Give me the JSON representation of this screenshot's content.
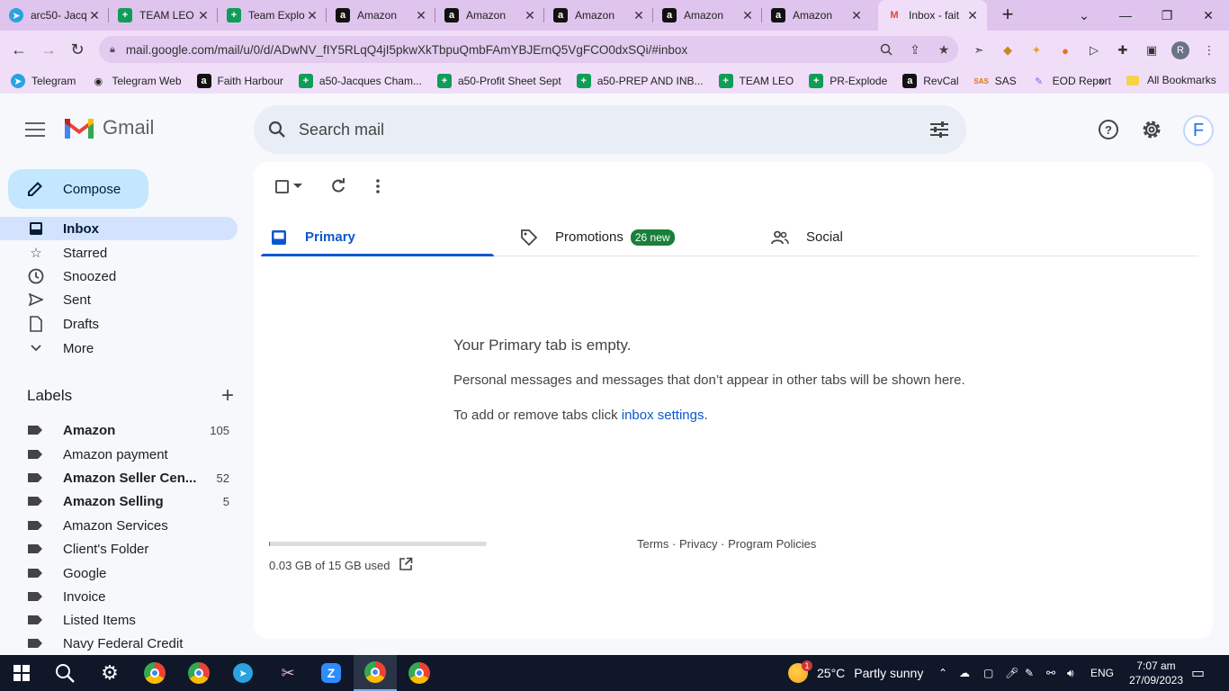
{
  "browser": {
    "tabs": [
      {
        "title": "arc50- Jacq",
        "favicon": "telegram-icon"
      },
      {
        "title": "TEAM LEO",
        "favicon": "sheets-icon"
      },
      {
        "title": "Team Explo",
        "favicon": "sheets-icon"
      },
      {
        "title": "Amazon",
        "favicon": "amazon-icon"
      },
      {
        "title": "Amazon",
        "favicon": "amazon-icon"
      },
      {
        "title": "Amazon",
        "favicon": "amazon-icon"
      },
      {
        "title": "Amazon",
        "favicon": "amazon-icon"
      },
      {
        "title": "Amazon",
        "favicon": "amazon-icon"
      },
      {
        "title": "Inbox - fait",
        "favicon": "gmail-icon",
        "active": true
      }
    ],
    "url": "mail.google.com/mail/u/0/d/ADwNV_fIY5RLqQ4jI5pkwXkTbpuQmbFAmYBJErnQ5VgFCO0dxSQi/#inbox",
    "profile_initial": "R",
    "bookmarks": [
      {
        "label": "Telegram",
        "icon": "telegram-icon"
      },
      {
        "label": "Telegram Web",
        "icon": "globe-icon"
      },
      {
        "label": "Faith Harbour",
        "icon": "amazon-icon"
      },
      {
        "label": "a50-Jacques Cham...",
        "icon": "sheets-icon"
      },
      {
        "label": "a50-Profit Sheet Sept",
        "icon": "sheets-icon"
      },
      {
        "label": "a50-PREP AND INB...",
        "icon": "sheets-icon"
      },
      {
        "label": "TEAM LEO",
        "icon": "sheets-icon"
      },
      {
        "label": "PR-Explode",
        "icon": "sheets-icon"
      },
      {
        "label": "RevCal",
        "icon": "amazon-icon"
      },
      {
        "label": "SAS",
        "icon": "sas-icon"
      },
      {
        "label": "EOD Report",
        "icon": "clickup-icon"
      }
    ],
    "bookmarks_more": "»",
    "all_bookmarks": "All Bookmarks"
  },
  "gmail": {
    "brand": "Gmail",
    "search_placeholder": "Search mail",
    "avatar_initial": "F",
    "compose_label": "Compose",
    "nav": [
      {
        "label": "Inbox",
        "icon": "inbox-icon",
        "active": true
      },
      {
        "label": "Starred",
        "icon": "star-icon"
      },
      {
        "label": "Snoozed",
        "icon": "clock-icon"
      },
      {
        "label": "Sent",
        "icon": "send-icon"
      },
      {
        "label": "Drafts",
        "icon": "draft-icon"
      },
      {
        "label": "More",
        "icon": "chevron-down-icon"
      }
    ],
    "labels_title": "Labels",
    "labels": [
      {
        "name": "Amazon",
        "count": "105",
        "bold": true
      },
      {
        "name": "Amazon payment",
        "count": "",
        "bold": false
      },
      {
        "name": "Amazon Seller Cen...",
        "count": "52",
        "bold": true
      },
      {
        "name": "Amazon Selling",
        "count": "5",
        "bold": true
      },
      {
        "name": "Amazon Services",
        "count": "",
        "bold": false
      },
      {
        "name": "Client's Folder",
        "count": "",
        "bold": false
      },
      {
        "name": "Google",
        "count": "",
        "bold": false
      },
      {
        "name": "Invoice",
        "count": "",
        "bold": false
      },
      {
        "name": "Listed Items",
        "count": "",
        "bold": false
      },
      {
        "name": "Navy Federal Credit",
        "count": "",
        "bold": false
      }
    ],
    "category_tabs": [
      {
        "label": "Primary",
        "icon": "inbox-icon",
        "active": true,
        "badge": ""
      },
      {
        "label": "Promotions",
        "icon": "tag-icon",
        "badge": "26 new"
      },
      {
        "label": "Social",
        "icon": "people-icon",
        "badge": ""
      }
    ],
    "empty": {
      "title": "Your Primary tab is empty.",
      "description": "Personal messages and messages that don’t appear in other tabs will be shown here.",
      "settings_prefix": "To add or remove tabs click ",
      "settings_link": "inbox settings",
      "settings_suffix": "."
    },
    "storage": {
      "text": "0.03 GB of 15 GB used",
      "used_fraction": 0.002
    },
    "footer": "Terms · Privacy · Program Policies"
  },
  "taskbar": {
    "weather_temp": "25°C",
    "weather_desc": "Partly sunny",
    "weather_badge": "1",
    "language": "ENG",
    "time": "7:07 am",
    "date": "27/09/2023"
  },
  "colors": {
    "chrome_frame": "#dfc4ee",
    "gmail_accent": "#0b57d0",
    "compose_bg": "#c2e7ff",
    "promotions_badge": "#188038"
  }
}
